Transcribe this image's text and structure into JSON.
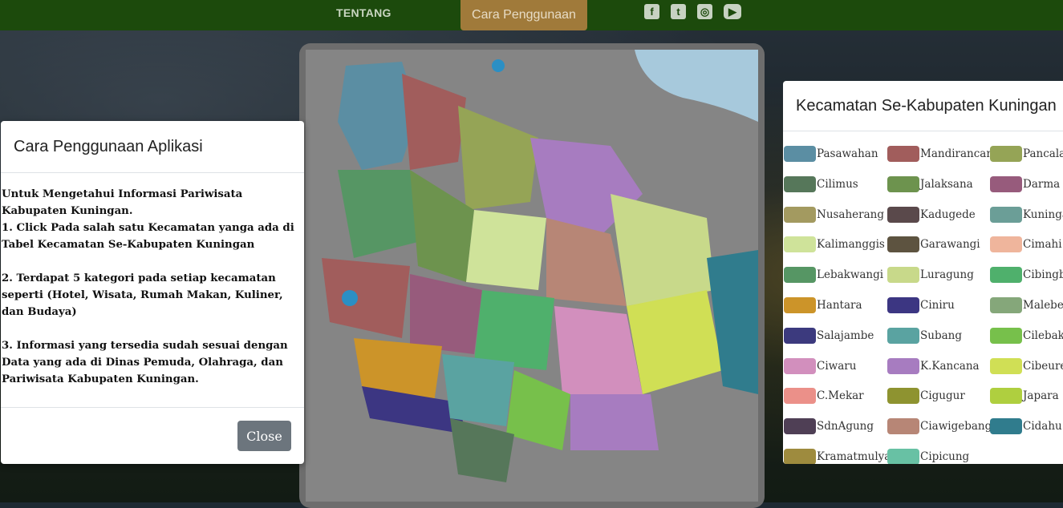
{
  "nav": {
    "tentang": "TENTANG",
    "cara": "Cara Penggunaan",
    "social": [
      {
        "icon": "facebook-icon",
        "glyph": "f"
      },
      {
        "icon": "twitter-icon",
        "glyph": "t"
      },
      {
        "icon": "instagram-icon",
        "glyph": "◎"
      },
      {
        "icon": "youtube-icon",
        "glyph": "▶"
      }
    ]
  },
  "modal": {
    "title": "Cara Penggunaan Aplikasi",
    "p1": "Untuk Mengetahui Informasi Pariwisata Kabupaten Kuningan.\n1. Click Pada salah satu Kecamatan yanga ada di Tabel Kecamatan Se-Kabupaten Kuningan",
    "p2": "2. Terdapat 5 kategori pada setiap kecamatan seperti (Hotel, Wisata, Rumah Makan, Kuliner, dan Budaya)",
    "p3": "3. Informasi yang tersedia sudah sesuai dengan Data yang ada di Dinas Pemuda, Olahraga, dan Pariwisata Kabupaten Kuningan.",
    "close_label": "Close"
  },
  "legend": {
    "title": "Kecamatan Se-Kabupaten Kuningan",
    "columns": [
      [
        {
          "label": "Pasawahan",
          "color": "#5b8ea3"
        },
        {
          "label": "Cilimus",
          "color": "#56775a"
        },
        {
          "label": "Nusaherang",
          "color": "#a39a60"
        },
        {
          "label": "Kalimanggis",
          "color": "#cfe39a"
        },
        {
          "label": "Lebakwangi",
          "color": "#569664"
        },
        {
          "label": "Hantara",
          "color": "#cc9429"
        },
        {
          "label": "Salajambe",
          "color": "#3c3a7e"
        },
        {
          "label": "Ciwaru",
          "color": "#d28fbd"
        },
        {
          "label": "C.Mekar",
          "color": "#eb9089"
        },
        {
          "label": "SdnAgung",
          "color": "#4f3f55"
        },
        {
          "label": "Kramatmulya",
          "color": "#9e8b3e"
        }
      ],
      [
        {
          "label": "Mandirancan",
          "color": "#a15d5c"
        },
        {
          "label": "Jalaksana",
          "color": "#6d934e"
        },
        {
          "label": "Kadugede",
          "color": "#5a494b"
        },
        {
          "label": "Garawangi",
          "color": "#5d5340"
        },
        {
          "label": "Luragung",
          "color": "#c8d98a"
        },
        {
          "label": "Ciniru",
          "color": "#3c3682"
        },
        {
          "label": "Subang",
          "color": "#5aa3a1"
        },
        {
          "label": "K.Kancana",
          "color": "#a77cc0"
        },
        {
          "label": "Cigugur",
          "color": "#8e9330"
        },
        {
          "label": "Ciawigebang",
          "color": "#b78676"
        },
        {
          "label": "Cipicung",
          "color": "#68c1a4"
        }
      ],
      [
        {
          "label": "Pancalang",
          "color": "#95a456"
        },
        {
          "label": "Darma",
          "color": "#975b7c"
        },
        {
          "label": "Kuningan",
          "color": "#6b9e97"
        },
        {
          "label": "Cimahi",
          "color": "#efb59c"
        },
        {
          "label": "Cibingbin",
          "color": "#4fb06c"
        },
        {
          "label": "Maleber",
          "color": "#85a77a"
        },
        {
          "label": "Cilebak",
          "color": "#77c04b"
        },
        {
          "label": "Cibeureum",
          "color": "#d0df55"
        },
        {
          "label": "Japara",
          "color": "#afcf3f"
        },
        {
          "label": "Cidahu",
          "color": "#307c8d"
        }
      ]
    ]
  }
}
